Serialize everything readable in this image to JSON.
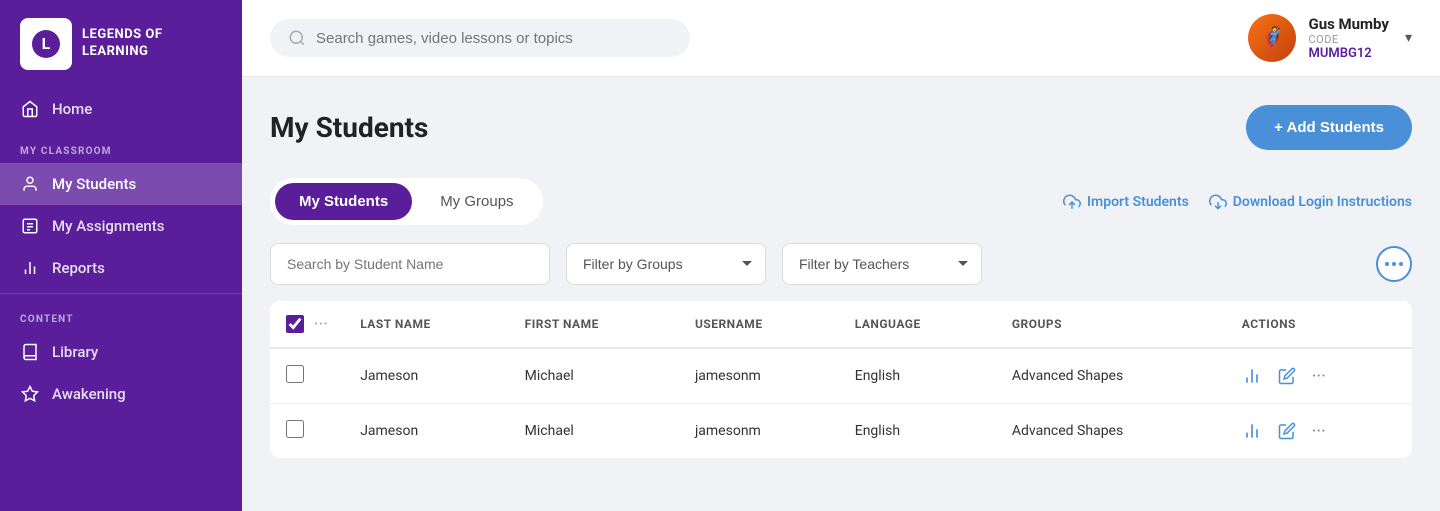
{
  "sidebar": {
    "logo_text": "LEGENDS OF\nLEARNING",
    "home_label": "Home",
    "section_classroom": "MY CLASSROOM",
    "my_students_label": "My Students",
    "my_assignments_label": "My Assignments",
    "reports_label": "Reports",
    "section_content": "CONTENT",
    "library_label": "Library",
    "awakening_label": "Awakening"
  },
  "topbar": {
    "search_placeholder": "Search games, video lessons or topics",
    "user_name": "Gus Mumby",
    "user_code_label": "CODE",
    "user_code": "MUMBG12"
  },
  "page": {
    "title": "My Students",
    "add_button_label": "+ Add Students"
  },
  "tabs": {
    "my_students_label": "My Students",
    "my_groups_label": "My Groups"
  },
  "actions": {
    "import_label": "Import Students",
    "download_label": "Download Login Instructions"
  },
  "filters": {
    "search_placeholder": "Search by Student Name",
    "groups_placeholder": "Filter by Groups",
    "teachers_placeholder": "Filter by Teachers"
  },
  "table": {
    "col_last_name": "LAST NAME",
    "col_first_name": "FIRST NAME",
    "col_username": "USERNAME",
    "col_language": "LANGUAGE",
    "col_groups": "GROUPS",
    "col_actions": "ACTIONS",
    "rows": [
      {
        "last_name": "Jameson",
        "first_name": "Michael",
        "username": "jamesonm",
        "language": "English",
        "groups": "Advanced Shapes"
      },
      {
        "last_name": "Jameson",
        "first_name": "Michael",
        "username": "jamesonm",
        "language": "English",
        "groups": "Advanced Shapes"
      }
    ]
  }
}
